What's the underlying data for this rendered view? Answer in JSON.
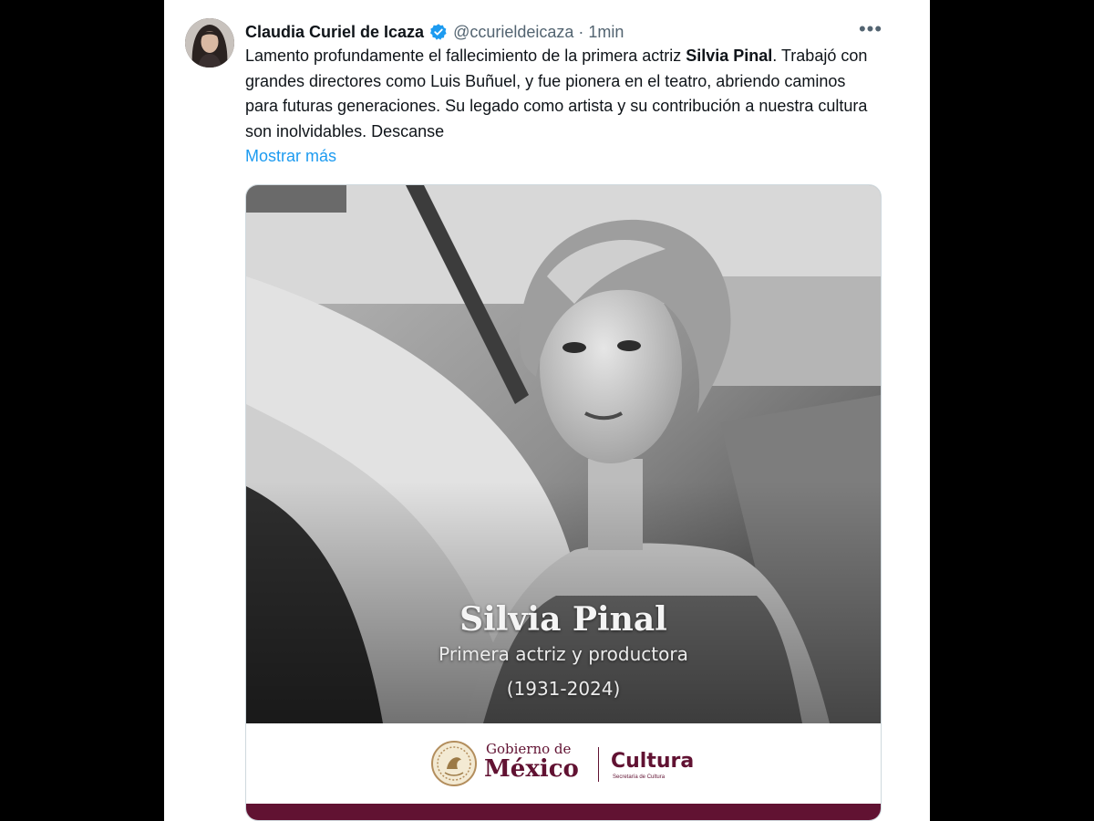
{
  "tweet": {
    "display_name": "Claudia Curiel de Icaza",
    "verified_icon": "verified-badge-icon",
    "handle": "@ccurieldeicaza",
    "separator": "·",
    "time": "1min",
    "more_label": "•••",
    "text_parts": {
      "p1": "Lamento profundamente el fallecimiento de la primera actriz ",
      "bold": "Silvia Pinal",
      "p2": ". Trabajó con grandes directores como Luis Buñuel, y fue pionera en el teatro, abriendo caminos para futuras generaciones. Su legado como artista y su contribución a nuestra cultura son inolvidables. Descanse"
    },
    "show_more": "Mostrar más"
  },
  "media": {
    "name": "Silvia Pinal",
    "role": "Primera actriz y productora",
    "years": "(1931-2024)",
    "logo": {
      "gob_line1": "Gobierno de",
      "gob_line2": "México",
      "cultura": "Cultura",
      "cultura_sub": "Secretaría de Cultura"
    }
  },
  "colors": {
    "link": "#1d9bf0",
    "verified": "#1d9bf0",
    "brand_maroon": "#611232",
    "text": "#0f1419",
    "muted": "#536471"
  }
}
